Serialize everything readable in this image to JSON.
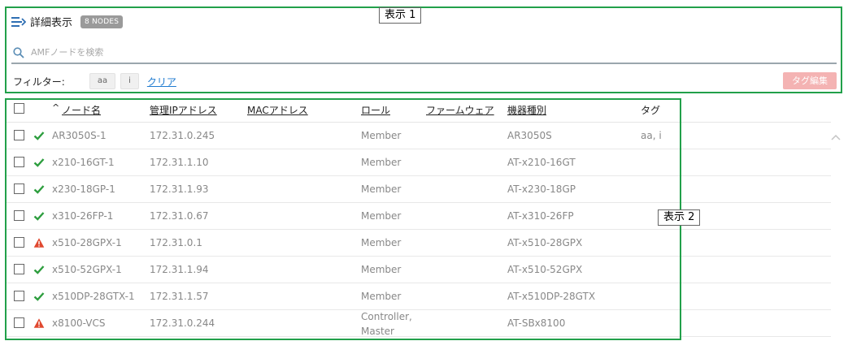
{
  "header": {
    "title": "詳細表示",
    "node_count": "8 NODES"
  },
  "search": {
    "placeholder": "AMFノードを検索"
  },
  "filter": {
    "label": "フィルター:",
    "chips": [
      "aa",
      "i"
    ],
    "clear_label": "クリア",
    "tag_edit_label": "タグ編集"
  },
  "annotations": {
    "label_1": "表示 1",
    "label_2": "表示 2"
  },
  "table": {
    "sort_indicator": "^",
    "columns": [
      "ノード名",
      "管理IPアドレス",
      "MACアドレス",
      "ロール",
      "ファームウェア",
      "機器種別",
      "タグ"
    ],
    "rows": [
      {
        "status": "ok",
        "name": "AR3050S-1",
        "ip": "172.31.0.245",
        "mac": "",
        "role": "Member",
        "role2": "",
        "firmware": "",
        "model": "AR3050S",
        "tags": "aa, i"
      },
      {
        "status": "ok",
        "name": "x210-16GT-1",
        "ip": "172.31.1.10",
        "mac": "",
        "role": "Member",
        "role2": "",
        "firmware": "",
        "model": "AT-x210-16GT",
        "tags": ""
      },
      {
        "status": "ok",
        "name": "x230-18GP-1",
        "ip": "172.31.1.93",
        "mac": "",
        "role": "Member",
        "role2": "",
        "firmware": "",
        "model": "AT-x230-18GP",
        "tags": ""
      },
      {
        "status": "ok",
        "name": "x310-26FP-1",
        "ip": "172.31.0.67",
        "mac": "",
        "role": "Member",
        "role2": "",
        "firmware": "",
        "model": "AT-x310-26FP",
        "tags": ""
      },
      {
        "status": "warning",
        "name": "x510-28GPX-1",
        "ip": "172.31.0.1",
        "mac": "",
        "role": "Member",
        "role2": "",
        "firmware": "",
        "model": "AT-x510-28GPX",
        "tags": ""
      },
      {
        "status": "ok",
        "name": "x510-52GPX-1",
        "ip": "172.31.1.94",
        "mac": "",
        "role": "Member",
        "role2": "",
        "firmware": "",
        "model": "AT-x510-52GPX",
        "tags": ""
      },
      {
        "status": "ok",
        "name": "x510DP-28GTX-1",
        "ip": "172.31.1.57",
        "mac": "",
        "role": "Member",
        "role2": "",
        "firmware": "",
        "model": "AT-x510DP-28GTX",
        "tags": ""
      },
      {
        "status": "warning",
        "name": "x8100-VCS",
        "ip": "172.31.0.244",
        "mac": "",
        "role": "Controller,",
        "role2": "Master",
        "firmware": "",
        "model": "AT-SBx8100",
        "tags": ""
      }
    ]
  },
  "colors": {
    "accent": "#1f7bd0",
    "ok": "#2e9e3f",
    "warning": "#e0482f",
    "annotation": "#22a04a",
    "tag_edit_bg": "#f4b3b3"
  },
  "icons": {
    "view_toggle": "list-expand-icon",
    "search": "search-icon",
    "ok": "check-icon",
    "warning": "warning-triangle-icon",
    "scroll": "chevron-up-icon"
  }
}
